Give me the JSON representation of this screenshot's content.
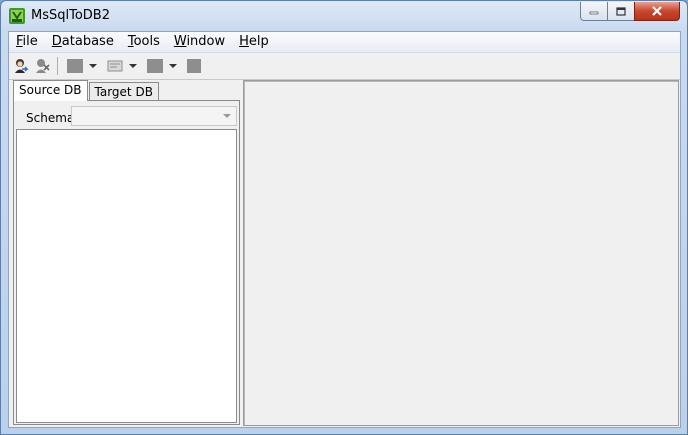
{
  "window": {
    "title": "MsSqlToDB2",
    "app_icon": "db-transfer-icon"
  },
  "menubar": {
    "items": [
      {
        "label": "File",
        "mnemonic": "F",
        "rest": "ile"
      },
      {
        "label": "Database",
        "mnemonic": "D",
        "rest": "atabase"
      },
      {
        "label": "Tools",
        "mnemonic": "T",
        "rest": "ools"
      },
      {
        "label": "Window",
        "mnemonic": "W",
        "rest": "indow"
      },
      {
        "label": "Help",
        "mnemonic": "H",
        "rest": "elp"
      }
    ]
  },
  "toolbar": {
    "buttons": [
      "connect-user-icon",
      "disconnect-icon",
      "tool-1-icon",
      "tool-2-icon",
      "tool-3-icon",
      "tool-4-icon"
    ]
  },
  "left_panel": {
    "tabs": [
      {
        "label": "Source DB",
        "active": true
      },
      {
        "label": "Target DB",
        "active": false
      }
    ],
    "schema_label": "Schema",
    "schema_value": ""
  },
  "colors": {
    "title_bg": "#c9daf0",
    "close_button": "#c9462f",
    "client_bg": "#f0f0f0"
  }
}
